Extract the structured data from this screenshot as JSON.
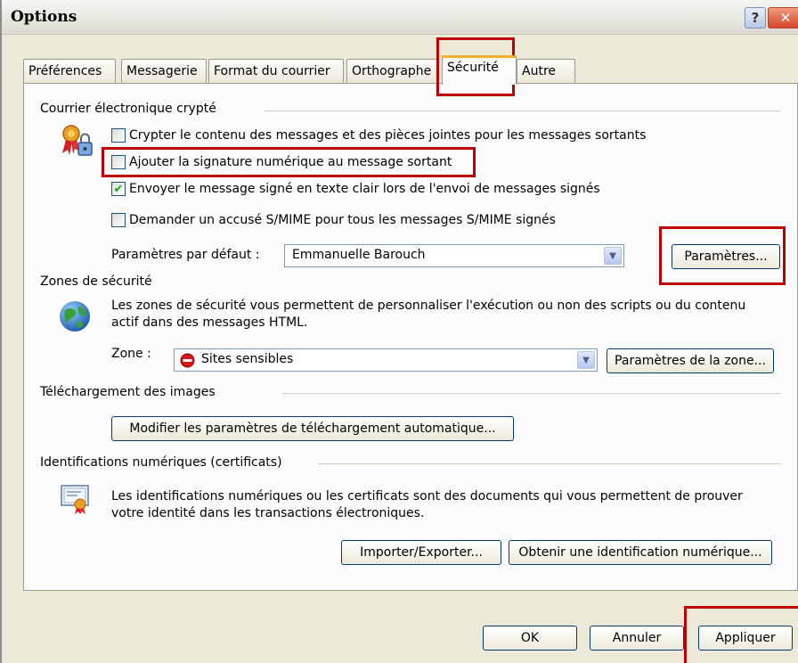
{
  "window": {
    "title": "Options",
    "help_glyph": "?",
    "close_glyph": "✕"
  },
  "tabs": [
    {
      "label": "Préférences"
    },
    {
      "label": "Messagerie"
    },
    {
      "label": "Format du courrier"
    },
    {
      "label": "Orthographe"
    },
    {
      "label": "Sécurité",
      "active": true
    },
    {
      "label": "Autre"
    }
  ],
  "secure_mail": {
    "title": "Courrier électronique crypté",
    "encrypt_label": "Crypter le contenu des messages et des pièces jointes pour les messages sortants",
    "encrypt_checked": false,
    "sign_label": "Ajouter la signature numérique au message sortant",
    "sign_checked": false,
    "clear_text_label": "Envoyer le message signé en texte clair lors de l'envoi de messages signés",
    "clear_text_checked": true,
    "receipt_label": "Demander un accusé S/MIME pour tous les messages S/MIME signés",
    "receipt_checked": false,
    "default_settings_label": "Paramètres par défaut :",
    "default_settings_value": "Emmanuelle Barouch",
    "settings_button": "Paramètres..."
  },
  "security_zones": {
    "title": "Zones de sécurité",
    "description": "Les zones de sécurité vous permettent de personnaliser l'exécution ou non des scripts ou du contenu actif dans des messages HTML.",
    "zone_label": "Zone :",
    "zone_value": "Sites sensibles",
    "zone_settings_button": "Paramètres de la zone..."
  },
  "image_download": {
    "title": "Téléchargement des images",
    "button": "Modifier les paramètres de téléchargement automatique..."
  },
  "digital_ids": {
    "title": "Identifications numériques (certificats)",
    "description": "Les identifications numériques ou les certificats sont des documents qui vous permettent de prouver votre identité dans les transactions électroniques.",
    "import_export_button": "Importer/Exporter...",
    "get_id_button": "Obtenir une identification numérique..."
  },
  "footer": {
    "ok": "OK",
    "cancel": "Annuler",
    "apply": "Appliquer"
  },
  "icons": {
    "certificate_lock": "certificate-lock-icon",
    "globe": "globe-icon",
    "restricted_zone": "restricted-zone-icon",
    "certificate": "certificate-icon"
  },
  "colors": {
    "highlight_box": "#c00000",
    "check": "#21a121",
    "tab_accent": "#f0b030"
  }
}
